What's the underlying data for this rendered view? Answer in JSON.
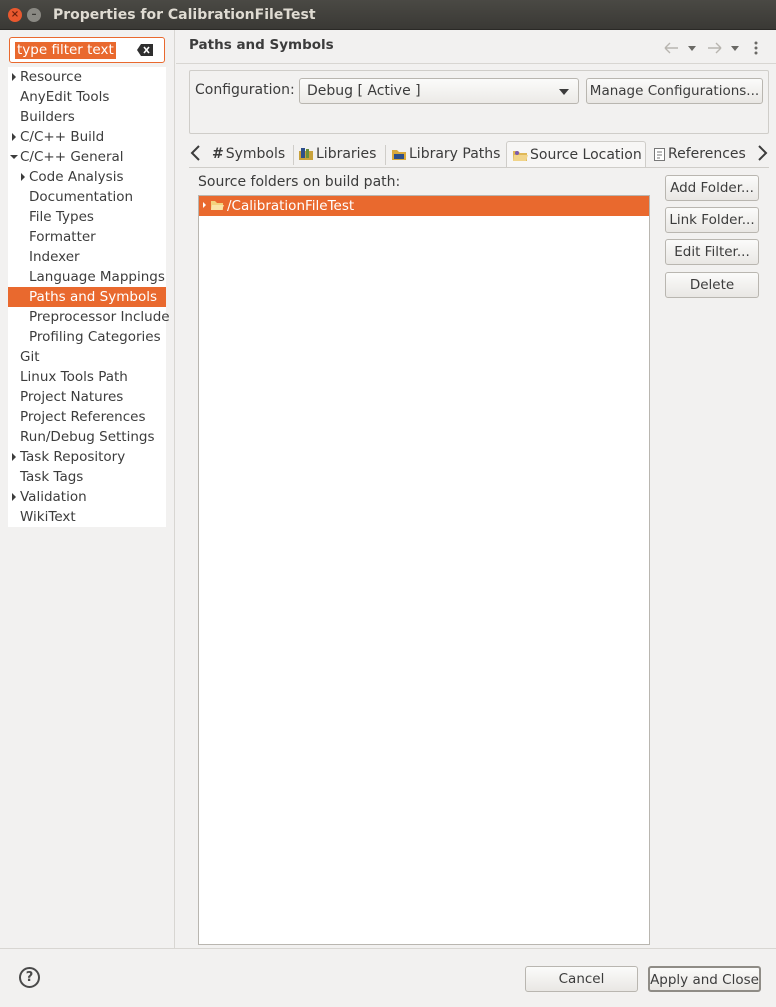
{
  "window": {
    "title": "Properties for CalibrationFileTest"
  },
  "filter": {
    "placeholder": "type filter text"
  },
  "tree": {
    "items": [
      {
        "label": "Resource",
        "toggle": "collapsed",
        "level": 0
      },
      {
        "label": "AnyEdit Tools",
        "toggle": "none",
        "level": 0
      },
      {
        "label": "Builders",
        "toggle": "none",
        "level": 0
      },
      {
        "label": "C/C++ Build",
        "toggle": "collapsed",
        "level": 0
      },
      {
        "label": "C/C++ General",
        "toggle": "expanded",
        "level": 0
      },
      {
        "label": "Code Analysis",
        "toggle": "collapsed",
        "level": 1
      },
      {
        "label": "Documentation",
        "toggle": "none",
        "level": 1
      },
      {
        "label": "File Types",
        "toggle": "none",
        "level": 1
      },
      {
        "label": "Formatter",
        "toggle": "none",
        "level": 1
      },
      {
        "label": "Indexer",
        "toggle": "none",
        "level": 1
      },
      {
        "label": "Language Mappings",
        "toggle": "none",
        "level": 1
      },
      {
        "label": "Paths and Symbols",
        "toggle": "none",
        "level": 1,
        "selected": true
      },
      {
        "label": "Preprocessor Include",
        "toggle": "none",
        "level": 1
      },
      {
        "label": "Profiling Categories",
        "toggle": "none",
        "level": 1
      },
      {
        "label": "Git",
        "toggle": "none",
        "level": 0
      },
      {
        "label": "Linux Tools Path",
        "toggle": "none",
        "level": 0
      },
      {
        "label": "Project Natures",
        "toggle": "none",
        "level": 0
      },
      {
        "label": "Project References",
        "toggle": "none",
        "level": 0
      },
      {
        "label": "Run/Debug Settings",
        "toggle": "none",
        "level": 0
      },
      {
        "label": "Task Repository",
        "toggle": "collapsed",
        "level": 0
      },
      {
        "label": "Task Tags",
        "toggle": "none",
        "level": 0
      },
      {
        "label": "Validation",
        "toggle": "collapsed",
        "level": 0
      },
      {
        "label": "WikiText",
        "toggle": "none",
        "level": 0
      }
    ]
  },
  "page": {
    "title": "Paths and Symbols"
  },
  "config": {
    "label": "Configuration:",
    "value": "Debug  [ Active ]",
    "manage_button": "Manage Configurations..."
  },
  "tabs": [
    {
      "label": "Symbols",
      "icon": "hash-icon"
    },
    {
      "label": "Libraries",
      "icon": "library-icon"
    },
    {
      "label": "Library Paths",
      "icon": "folder-icon"
    },
    {
      "label": "Source Location",
      "icon": "source-folder-icon",
      "active": true
    },
    {
      "label": "References",
      "icon": "reference-icon"
    }
  ],
  "source": {
    "label": "Source folders on build path:",
    "folders": [
      "/CalibrationFileTest"
    ],
    "buttons": {
      "add_folder": "Add Folder...",
      "link_folder": "Link Folder...",
      "edit_filter": "Edit Filter...",
      "delete": "Delete"
    }
  },
  "footer": {
    "help": "?",
    "cancel": "Cancel",
    "apply_close": "Apply and Close"
  },
  "colors": {
    "selection": "#e9692e",
    "titlebar": "#3c3b37"
  }
}
